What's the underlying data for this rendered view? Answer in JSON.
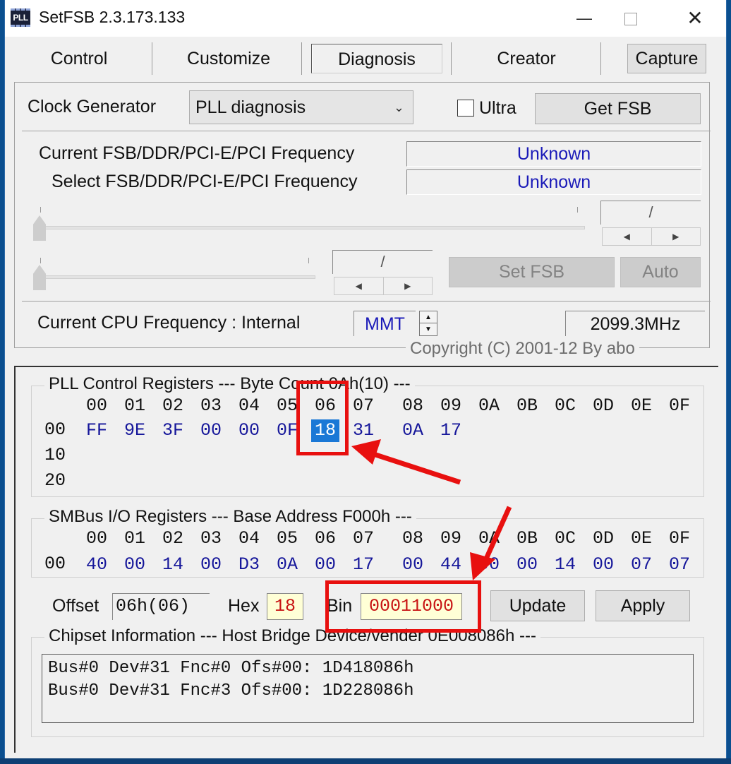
{
  "window": {
    "title": "SetFSB 2.3.173.133",
    "app_icon_text": "PLL",
    "controls": {
      "minimize": "—",
      "close": "✕"
    }
  },
  "tabs": [
    {
      "label": "Control",
      "active": false
    },
    {
      "label": "Customize",
      "active": false
    },
    {
      "label": "Diagnosis",
      "active": true
    },
    {
      "label": "Creator",
      "active": false
    }
  ],
  "toolbar": {
    "capture_label": "Capture"
  },
  "clock": {
    "label": "Clock Generator",
    "selected": "PLL diagnosis",
    "ultra_label": "Ultra",
    "ultra_checked": false,
    "get_fsb_label": "Get FSB"
  },
  "frequency": {
    "current_label": "Current FSB/DDR/PCI-E/PCI Frequency",
    "current_value": "Unknown",
    "select_label": "Select FSB/DDR/PCI-E/PCI Frequency",
    "select_value": "Unknown",
    "spin1_value": "/",
    "spin2_value": "/",
    "slider1_value": 0,
    "slider2_value": 0,
    "set_fsb_label": "Set FSB",
    "auto_label": "Auto"
  },
  "cpu": {
    "label": "Current CPU Frequency : Internal",
    "mode": "MMT",
    "value": "2099.3MHz"
  },
  "copyright": "Copyright (C) 2001-12 By abo",
  "pll_registers": {
    "title": "PLL Control Registers  --- Byte Count 0Ah(10) ---",
    "columns": [
      "00",
      "01",
      "02",
      "03",
      "04",
      "05",
      "06",
      "07",
      "08",
      "09",
      "0A",
      "0B",
      "0C",
      "0D",
      "0E",
      "0F"
    ],
    "rows": [
      {
        "label": "00",
        "values": [
          "FF",
          "9E",
          "3F",
          "00",
          "00",
          "0F",
          "18",
          "31",
          "0A",
          "17",
          "",
          "",
          "",
          "",
          "",
          ""
        ]
      },
      {
        "label": "10",
        "values": [
          "",
          "",
          "",
          "",
          "",
          "",
          "",
          "",
          "",
          "",
          "",
          "",
          "",
          "",
          "",
          ""
        ]
      },
      {
        "label": "20",
        "values": [
          "",
          "",
          "",
          "",
          "",
          "",
          "",
          "",
          "",
          "",
          "",
          "",
          "",
          "",
          "",
          ""
        ]
      }
    ],
    "selected": {
      "row": 0,
      "col": 6
    }
  },
  "smbus_registers": {
    "title": "SMBus I/O Registers  --- Base Address F000h ---",
    "columns": [
      "00",
      "01",
      "02",
      "03",
      "04",
      "05",
      "06",
      "07",
      "08",
      "09",
      "0A",
      "0B",
      "0C",
      "0D",
      "0E",
      "0F"
    ],
    "rows": [
      {
        "label": "00",
        "values": [
          "40",
          "00",
          "14",
          "00",
          "D3",
          "0A",
          "00",
          "17",
          "00",
          "44",
          "00",
          "00",
          "14",
          "00",
          "07",
          "07"
        ]
      }
    ]
  },
  "editor": {
    "offset_label": "Offset",
    "offset_value": "06h(06)",
    "hex_label": "Hex",
    "hex_value": "18",
    "bin_label": "Bin",
    "bin_value": "00011000",
    "update_label": "Update",
    "apply_label": "Apply"
  },
  "chipset": {
    "title": "Chipset Information  --- Host Bridge Device/vender 0E008086h ---",
    "lines": [
      "Bus#0 Dev#31 Fnc#0 Ofs#00: 1D418086h",
      "Bus#0 Dev#31 Fnc#3 Ofs#00: 1D228086h"
    ]
  },
  "annotations": {
    "highlight_color": "#e8100f"
  }
}
